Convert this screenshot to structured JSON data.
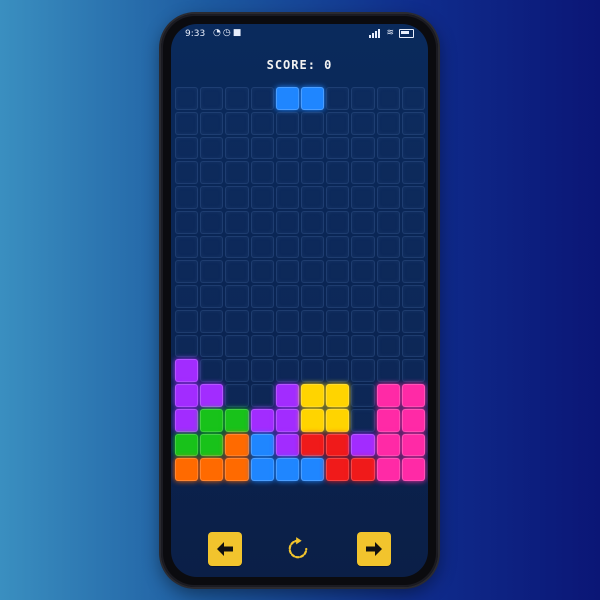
{
  "status_bar": {
    "time": "9:33",
    "left_icons": [
      "notification-icon",
      "alarm-icon",
      "video-icon"
    ],
    "right_icons": [
      "signal-icon",
      "wifi-icon",
      "battery-icon"
    ]
  },
  "score": {
    "label": "SCORE: 0",
    "value": 0
  },
  "board": {
    "columns": 10,
    "rows": 16,
    "colors": {
      "P": "#a22cff",
      "G": "#18c21a",
      "O": "#ff6a00",
      "B": "#1f86ff",
      "Y": "#ffd400",
      "R": "#f01a1a",
      "K": "#ff2aa6"
    },
    "active_piece": {
      "color": "#1f86ff",
      "cells": [
        [
          0,
          4
        ],
        [
          0,
          5
        ]
      ]
    },
    "grid": [
      "..........",
      "..........",
      "..........",
      "..........",
      "..........",
      "..........",
      "..........",
      "..........",
      "..........",
      "..........",
      "..........",
      "P.........",
      "PP..PYY.KK",
      "PGGPPYY.KK",
      "GGOBPRRPKK",
      "OOOBBBRRKK"
    ]
  },
  "controls": {
    "left": "arrow-left-icon",
    "rotate": "rotate-icon",
    "right": "arrow-right-icon"
  },
  "colors": {
    "button": "#f2c42d",
    "rotate_icon": "#f2c42d"
  }
}
